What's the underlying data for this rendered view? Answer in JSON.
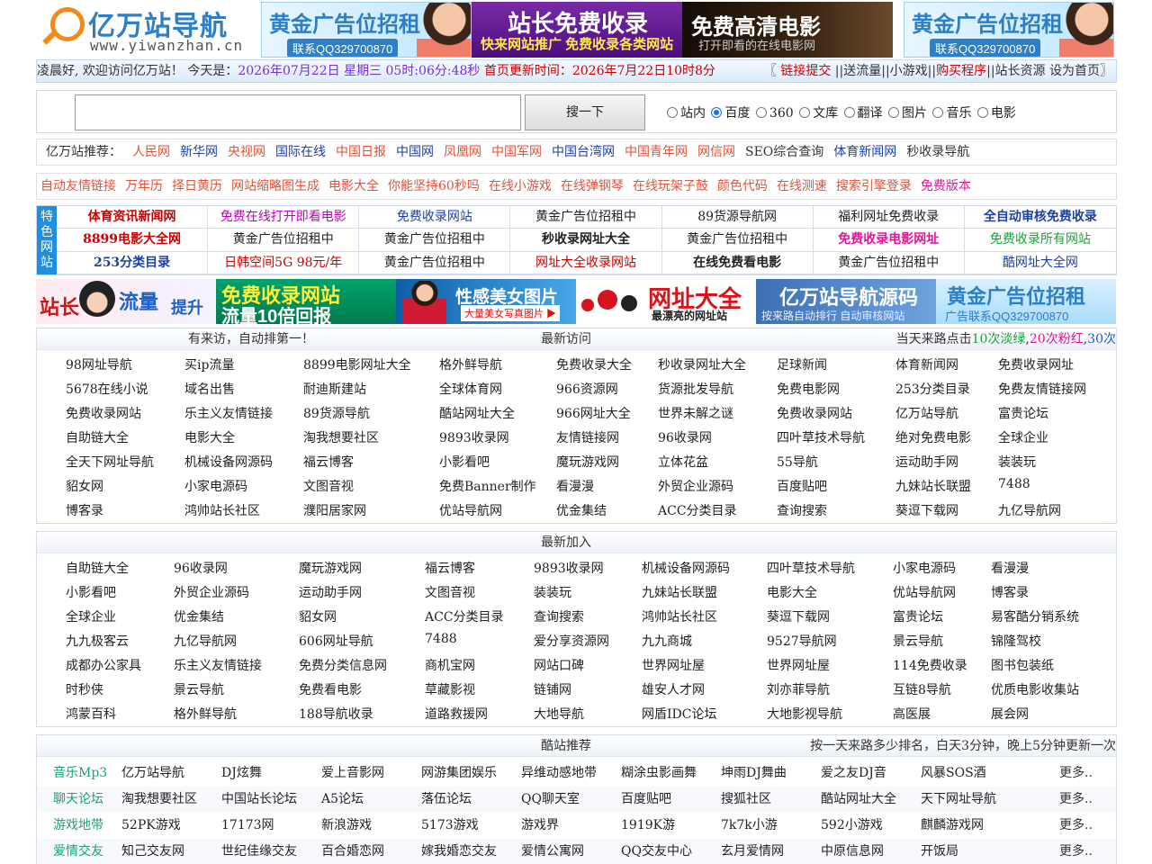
{
  "header": {
    "logo_brand": "亿万站导航",
    "logo_url": "www.yiwanzhan.cn",
    "banner1": {
      "title": "黄金广告位招租",
      "sub": "联系QQ329700870"
    },
    "banner2": {
      "title": "站长免费收录",
      "sub": "快来网站推广 免费收录各类网站"
    },
    "banner3": {
      "title": "免费高清电影",
      "sub": "打开即看的在线电影网"
    },
    "banner4": {
      "title": "黄金广告位招租",
      "sub": "联系QQ329700870"
    }
  },
  "infobar": {
    "greeting": "凌晨好, 欢迎访问亿万站！ 今天是：",
    "date": "2026年07月22日 星期三 05时:06分:48秒",
    "update": " 首页更新时间：2026年7月22日10时8分",
    "link_submit": "链接提交",
    "rest": "||送流量||小游戏||",
    "buy": "购买程序",
    "rest2": "||站长资源 设为首页",
    "open_bracket": "〖",
    "close_bracket": "〗"
  },
  "search": {
    "placeholder": "",
    "button": "搜一下",
    "options": [
      {
        "label": "站内",
        "checked": false
      },
      {
        "label": "百度",
        "checked": true
      },
      {
        "label": "360",
        "checked": false
      },
      {
        "label": "文库",
        "checked": false
      },
      {
        "label": "翻译",
        "checked": false
      },
      {
        "label": "图片",
        "checked": false
      },
      {
        "label": "音乐",
        "checked": false
      },
      {
        "label": "电影",
        "checked": false
      }
    ]
  },
  "recommend": {
    "label": "亿万站推荐：",
    "items": [
      {
        "label": "人民网",
        "color": "#e0523a"
      },
      {
        "label": "新华网",
        "color": "#1c3fa8"
      },
      {
        "label": "央视网",
        "color": "#e0523a"
      },
      {
        "label": "国际在线",
        "color": "#1c3fa8"
      },
      {
        "label": "中国日报",
        "color": "#e0523a"
      },
      {
        "label": "中国网",
        "color": "#1c3fa8"
      },
      {
        "label": "凤凰网",
        "color": "#e0523a"
      },
      {
        "label": "中国军网",
        "color": "#e0523a"
      },
      {
        "label": "中国台湾网",
        "color": "#1c3fa8"
      },
      {
        "label": "中国青年网",
        "color": "#e0523a"
      },
      {
        "label": "网信网",
        "color": "#e0523a"
      },
      {
        "label": "SEO综合查询",
        "color": "#333333"
      },
      {
        "label": "体育新闻网",
        "color": "#1c3fa8"
      },
      {
        "label": "秒收录导航",
        "color": "#333333"
      }
    ]
  },
  "tools": [
    "自动友情链接",
    "万年历",
    "择日黄历",
    "网站缩略图生成",
    "电影大全",
    "你能坚持60秒吗",
    "在线小游戏",
    "在线弹钢琴",
    "在线玩架子鼓",
    "颜色代码",
    "在线测速",
    "搜索引擎登录",
    "免费版本"
  ],
  "feature": {
    "side_label": "特色网站",
    "cells": [
      {
        "label": "体育资讯新闻网",
        "color": "#cc0000",
        "bold": true
      },
      {
        "label": "免费在线打开即看电影",
        "color": "#c000c0",
        "bold": false
      },
      {
        "label": "免费收录网站",
        "color": "#1c3fa8",
        "bold": false
      },
      {
        "label": "黄金广告位招租中",
        "color": "#222222",
        "bold": false
      },
      {
        "label": "89货源导航网",
        "color": "#222222",
        "bold": false
      },
      {
        "label": "福利网址免费收录",
        "color": "#222222",
        "bold": false
      },
      {
        "label": "全自动审核免费收录",
        "color": "#1c3fa8",
        "bold": true
      },
      {
        "label": "8899电影大全网",
        "color": "#cc0000",
        "bold": true
      },
      {
        "label": "黄金广告位招租中",
        "color": "#222222",
        "bold": false
      },
      {
        "label": "黄金广告位招租中",
        "color": "#222222",
        "bold": false
      },
      {
        "label": "秒收录网址大全",
        "color": "#222222",
        "bold": true
      },
      {
        "label": "黄金广告位招租中",
        "color": "#222222",
        "bold": false
      },
      {
        "label": "免费收录电影网址",
        "color": "#e0169b",
        "bold": true
      },
      {
        "label": "免费收录所有网站",
        "color": "#1aa33b",
        "bold": false
      },
      {
        "label": "253分类目录",
        "color": "#1c3fa8",
        "bold": true
      },
      {
        "label": "日韩空间5G 98元/年",
        "color": "#cc0000",
        "bold": false
      },
      {
        "label": "黄金广告位招租中",
        "color": "#222222",
        "bold": false
      },
      {
        "label": "网址大全收录网站",
        "color": "#cc0000",
        "bold": false
      },
      {
        "label": "在线免费看电影",
        "color": "#222222",
        "bold": true
      },
      {
        "label": "黄金广告位招租中",
        "color": "#222222",
        "bold": false
      },
      {
        "label": "酷网址大全网",
        "color": "#1c3fa8",
        "bold": false
      }
    ]
  },
  "adstrip": {
    "ad1": {
      "a": "站长",
      "b": "流量",
      "c": "提升"
    },
    "ad2": {
      "a": "免费收录网站",
      "b": "流量10倍回报"
    },
    "ad3": {
      "a": "性感美女图片",
      "b": "大量美女写真图片 ▶"
    },
    "ad4": {
      "a": "网址大全",
      "b": "最漂亮的网址站"
    },
    "ad5": {
      "a": "亿万站导航源码",
      "b": "按来路自动排行  自动审核网站"
    },
    "ad6": {
      "a": "黄金广告位招租",
      "b": "广告联系QQ329700870"
    }
  },
  "visits": {
    "head_left": "有来访，自动排第一！",
    "head_mid": "最新访问",
    "head_right_pre": "当天来路点击",
    "head_right_g": "10次淡绿",
    "head_right_sep": ",",
    "head_right_m": "20次粉红",
    "head_right_sep2": ",",
    "head_right_b": "30次",
    "rows": [
      [
        "98网址导航",
        "买ip流量",
        "8899电影网址大全",
        "格外鲜导航",
        "免费收录大全",
        "秒收录网址大全",
        "足球新闻",
        "体育新闻网",
        "免费收录网址"
      ],
      [
        "5678在线小说",
        "域名出售",
        "耐迪斯建站",
        "全球体育网",
        "966资源网",
        "货源批发导航",
        "免费电影网",
        "253分类目录",
        "免费友情链接网"
      ],
      [
        "免费收录网站",
        "乐主义友情链接",
        "89货源导航",
        "酷站网址大全",
        "966网址大全",
        "世界未解之谜",
        "免费收录网站",
        "亿万站导航",
        "富贵论坛"
      ],
      [
        "自助链大全",
        "电影大全",
        "淘我想要社区",
        "9893收录网",
        "友情链接网",
        "96收录网",
        "四叶草技术导航",
        "绝对免费电影",
        "全球企业"
      ],
      [
        "全天下网址导航",
        "机械设备网源码",
        "福云博客",
        "小影看吧",
        "魔玩游戏网",
        "立体花盆",
        "55导航",
        "运动助手网",
        "装装玩"
      ],
      [
        "貂女网",
        "小家电源码",
        "文图音视",
        "免费Banner制作",
        "看漫漫",
        "外贸企业源码",
        "百度贴吧",
        "九妹站长联盟",
        "7488"
      ],
      [
        "博客录",
        "鸿帅站长社区",
        "濮阳居家网",
        "优站导航网",
        "优金集结",
        "ACC分类目录",
        "查询搜索",
        "葵逗下载网",
        "九亿导航网"
      ]
    ]
  },
  "newadd": {
    "head": "最新加入",
    "rows": [
      [
        "自助链大全",
        "96收录网",
        "魔玩游戏网",
        "福云博客",
        "9893收录网",
        "机械设备网源码",
        "四叶草技术导航",
        "小家电源码",
        "看漫漫"
      ],
      [
        "小影看吧",
        "外贸企业源码",
        "运动助手网",
        "文图音视",
        "装装玩",
        "九妹站长联盟",
        "电影大全",
        "优站导航网",
        "博客录"
      ],
      [
        "全球企业",
        "优金集结",
        "貂女网",
        "ACC分类目录",
        "查询搜索",
        "鸿帅站长社区",
        "葵逗下载网",
        "富贵论坛",
        "易客酷分销系统"
      ],
      [
        "九九极客云",
        "九亿导航网",
        "606网址导航",
        "7488",
        "爱分享资源网",
        "九九商城",
        "9527导航网",
        "景云导航",
        "锦隆驾校"
      ],
      [
        "成都办公家具",
        "乐主义友情链接",
        "免费分类信息网",
        "商机宝网",
        "网站口碑",
        "世界网址屋",
        "世界网址屋",
        "114免费收录",
        "图书包装纸"
      ],
      [
        "时秒侠",
        "景云导航",
        "免费看电影",
        "草藏影视",
        "链铺网",
        "雄安人才网",
        "刘亦菲导航",
        "互链8导航",
        "优质电影收集站"
      ],
      [
        "鸿蒙百科",
        "格外鲜导航",
        "188导航收录",
        "道路救援网",
        "大地导航",
        "网盾IDC论坛",
        "大地影视导航",
        "高医展",
        "展会网"
      ]
    ]
  },
  "cool": {
    "head": "酷站推荐",
    "head_right": "按一天来路多少排名，白天3分钟，晚上5分钟更新一次",
    "more": "更多..",
    "rows": [
      {
        "cat": "音乐Mp3",
        "items": [
          "亿万站导航",
          "DJ炫舞",
          "爱上音影网",
          "网游集团娱乐",
          "异维动感地带",
          "糊涂虫影画舞",
          "坤雨DJ舞曲",
          "爱之友DJ音",
          "风暴SOS酒"
        ]
      },
      {
        "cat": "聊天论坛",
        "items": [
          "淘我想要社区",
          "中国站长论坛",
          "A5论坛",
          "落伍论坛",
          "QQ聊天室",
          "百度贴吧",
          "搜狐社区",
          "酷站网址大全",
          "天下网址导航"
        ]
      },
      {
        "cat": "游戏地带",
        "items": [
          "52PK游戏",
          "17173网",
          "新浪游戏",
          "5173游戏",
          "游戏界",
          "1919K游",
          "7k7k小游",
          "592小游戏",
          "麒麟游戏网"
        ]
      },
      {
        "cat": "爱情交友",
        "items": [
          "知己交友网",
          "世纪佳缘交友",
          "百合婚恋网",
          "嫁我婚恋交友",
          "爱情公寓网",
          "QQ交友中心",
          "玄月爱情网",
          "中原信息网",
          "开饭局"
        ]
      }
    ]
  }
}
